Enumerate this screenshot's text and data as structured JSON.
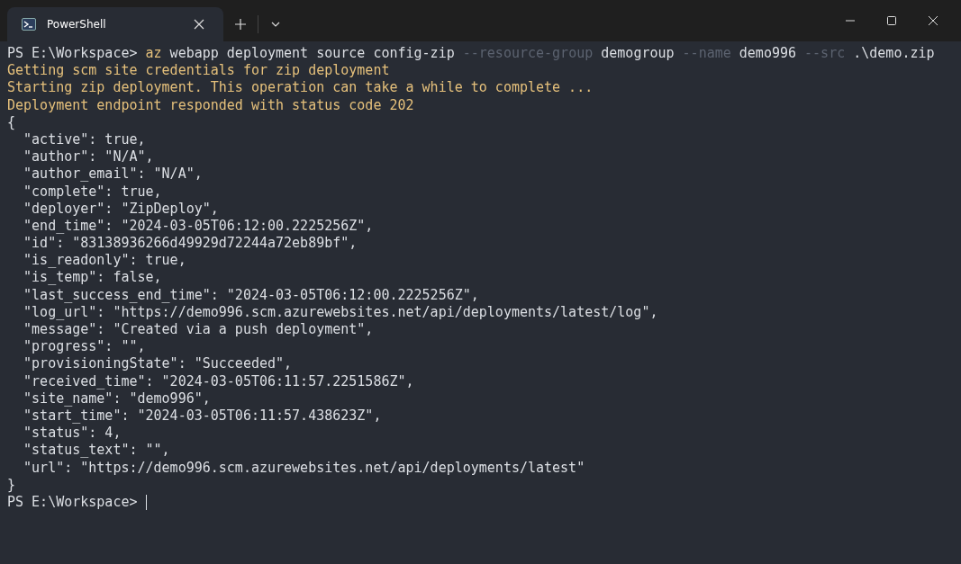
{
  "tab": {
    "title": "PowerShell",
    "selected": true
  },
  "lines": [
    [
      {
        "kind": "prompt",
        "text": "PS E:\\Workspace> "
      },
      {
        "kind": "command",
        "text": "az"
      },
      {
        "kind": "plain",
        "text": " webapp deployment source config-zip "
      },
      {
        "kind": "param",
        "text": "--resource-group"
      },
      {
        "kind": "plain",
        "text": " demogroup "
      },
      {
        "kind": "param",
        "text": "--name"
      },
      {
        "kind": "plain",
        "text": " demo996 "
      },
      {
        "kind": "param",
        "text": "--src"
      },
      {
        "kind": "plain",
        "text": " .\\demo.zip"
      }
    ],
    [
      {
        "kind": "warning",
        "text": "Getting scm site credentials for zip deployment"
      }
    ],
    [
      {
        "kind": "warning",
        "text": "Starting zip deployment. This operation can take a while to complete ..."
      }
    ],
    [
      {
        "kind": "warning",
        "text": "Deployment endpoint responded with status code 202"
      }
    ],
    [
      {
        "kind": "plain",
        "text": "{"
      }
    ],
    [
      {
        "kind": "plain",
        "text": "  \"active\": true,"
      }
    ],
    [
      {
        "kind": "plain",
        "text": "  \"author\": \"N/A\","
      }
    ],
    [
      {
        "kind": "plain",
        "text": "  \"author_email\": \"N/A\","
      }
    ],
    [
      {
        "kind": "plain",
        "text": "  \"complete\": true,"
      }
    ],
    [
      {
        "kind": "plain",
        "text": "  \"deployer\": \"ZipDeploy\","
      }
    ],
    [
      {
        "kind": "plain",
        "text": "  \"end_time\": \"2024-03-05T06:12:00.2225256Z\","
      }
    ],
    [
      {
        "kind": "plain",
        "text": "  \"id\": \"83138936266d49929d72244a72eb89bf\","
      }
    ],
    [
      {
        "kind": "plain",
        "text": "  \"is_readonly\": true,"
      }
    ],
    [
      {
        "kind": "plain",
        "text": "  \"is_temp\": false,"
      }
    ],
    [
      {
        "kind": "plain",
        "text": "  \"last_success_end_time\": \"2024-03-05T06:12:00.2225256Z\","
      }
    ],
    [
      {
        "kind": "plain",
        "text": "  \"log_url\": \"https://demo996.scm.azurewebsites.net/api/deployments/latest/log\","
      }
    ],
    [
      {
        "kind": "plain",
        "text": "  \"message\": \"Created via a push deployment\","
      }
    ],
    [
      {
        "kind": "plain",
        "text": "  \"progress\": \"\","
      }
    ],
    [
      {
        "kind": "plain",
        "text": "  \"provisioningState\": \"Succeeded\","
      }
    ],
    [
      {
        "kind": "plain",
        "text": "  \"received_time\": \"2024-03-05T06:11:57.2251586Z\","
      }
    ],
    [
      {
        "kind": "plain",
        "text": "  \"site_name\": \"demo996\","
      }
    ],
    [
      {
        "kind": "plain",
        "text": "  \"start_time\": \"2024-03-05T06:11:57.438623Z\","
      }
    ],
    [
      {
        "kind": "plain",
        "text": "  \"status\": 4,"
      }
    ],
    [
      {
        "kind": "plain",
        "text": "  \"status_text\": \"\","
      }
    ],
    [
      {
        "kind": "plain",
        "text": "  \"url\": \"https://demo996.scm.azurewebsites.net/api/deployments/latest\""
      }
    ],
    [
      {
        "kind": "plain",
        "text": "}"
      }
    ],
    [
      {
        "kind": "prompt",
        "text": "PS E:\\Workspace> "
      }
    ]
  ]
}
